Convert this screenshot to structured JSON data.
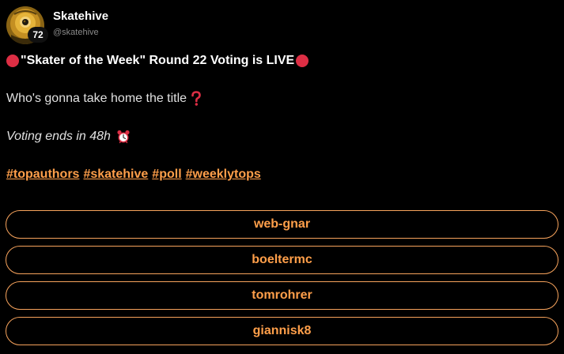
{
  "author": {
    "name": "Skatehive",
    "handle": "@skatehive",
    "reputation": "72",
    "avatar_icon": "skatehive-logo-icon"
  },
  "post": {
    "headline": "\"Skater of the Week\" Round 22 Voting is LIVE",
    "headline_icon": "red-circle-icon",
    "question": "Who's gonna take home the title",
    "question_icon": "red-question-mark-icon",
    "voting_note": "Voting ends in 48h",
    "voting_icon": "alarm-clock-icon",
    "hashtags": [
      "#topauthors",
      "#skatehive",
      "#poll",
      "#weeklytops"
    ]
  },
  "poll": {
    "options": [
      "web-gnar",
      "boeltermc",
      "tomrohrer",
      "giannisk8"
    ]
  },
  "colors": {
    "accent": "#ff9f4a",
    "border": "#f7a35c",
    "background": "#000000",
    "red": "#dd2e44"
  }
}
